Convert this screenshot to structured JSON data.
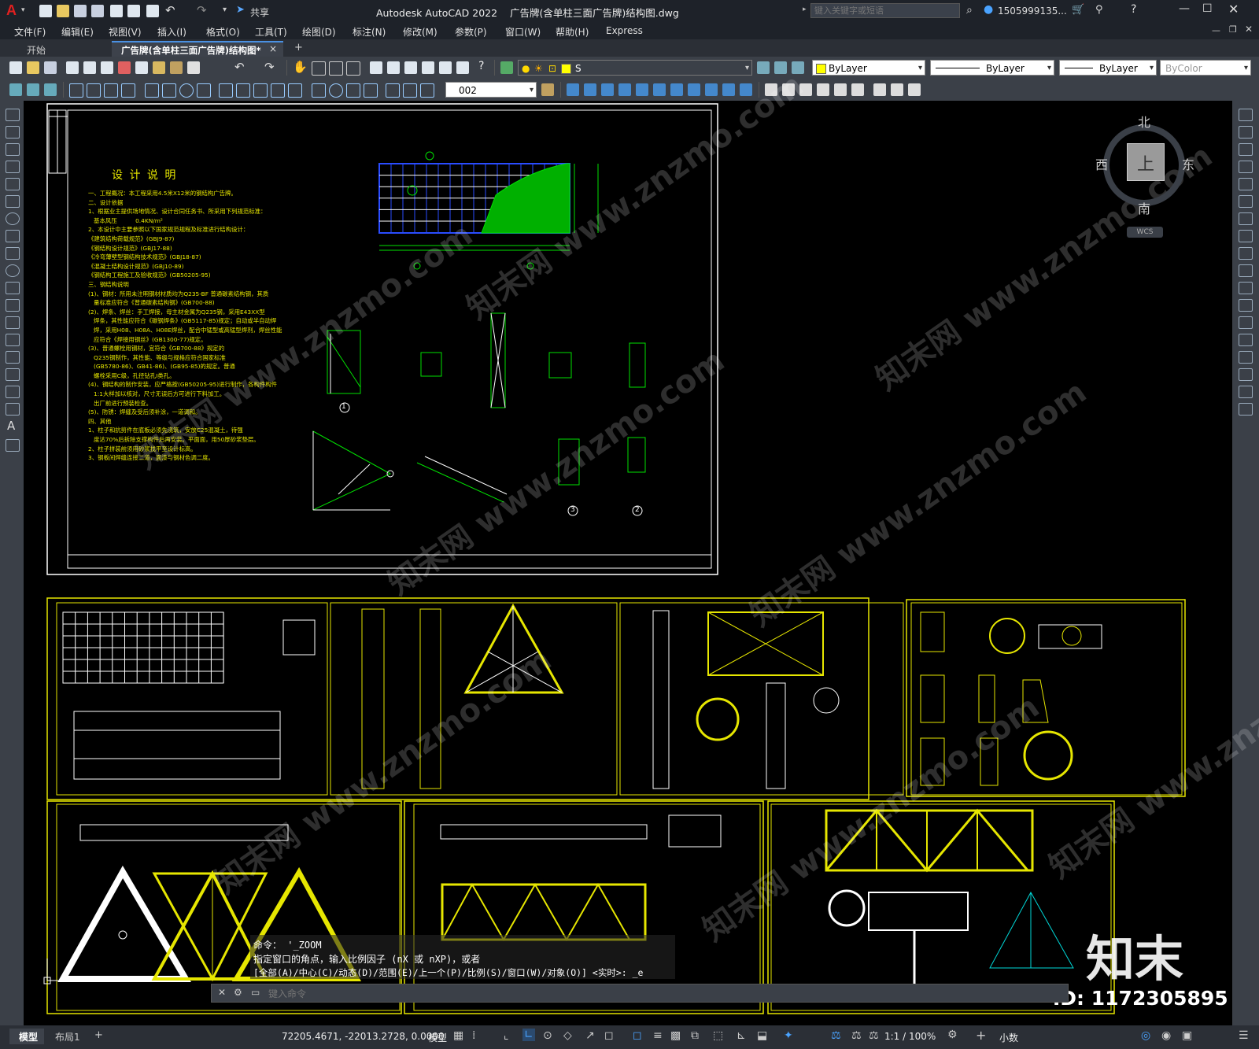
{
  "titlebar": {
    "app_logo": "A",
    "share_label": "共享",
    "title": "Autodesk AutoCAD 2022    广告牌(含单柱三面广告牌)结构图.dwg",
    "search_placeholder": "键入关键字或短语",
    "user": "1505999135...",
    "icons": [
      "new-icon",
      "open-icon",
      "save-icon",
      "saveas-icon",
      "plot-icon",
      "undo-icon",
      "redo-icon",
      "share-icon",
      "search-icon",
      "user-icon",
      "cart-icon",
      "help-icon",
      "minimize-icon",
      "maximize-icon",
      "close-icon"
    ]
  },
  "menubar": {
    "items": [
      "文件(F)",
      "编辑(E)",
      "视图(V)",
      "插入(I)",
      "格式(O)",
      "工具(T)",
      "绘图(D)",
      "标注(N)",
      "修改(M)",
      "参数(P)",
      "窗口(W)",
      "帮助(H)",
      "Express"
    ]
  },
  "tabs": {
    "start": "开始",
    "active": "广告牌(含单柱三面广告牌)结构图*",
    "close": "×",
    "add": "+"
  },
  "toolbar": {
    "layer_value": "S",
    "color_value": "ByLayer",
    "linetype_value": "ByLayer",
    "lineweight_value": "ByLayer",
    "plotstyle_value": "ByColor",
    "dimstyle_value": "002",
    "layer_color": "#ffff00"
  },
  "viewcube": {
    "north": "北",
    "south": "南",
    "east": "东",
    "west": "西",
    "top": "上",
    "wcs": "WCS"
  },
  "drawing": {
    "title": "设 计 说 明",
    "notes": [
      "一、工程概况：本工程采用4.5米X12米的钢结构广告牌。",
      "二、设计依据",
      "1、根据业主提供场地情况、设计合同任务书、所采用下列规范标准：",
      "   基本风压          0.4KN/m²",
      "2、本设计中主要参照以下国家规范规程及标准进行结构设计：",
      "《建筑结构荷载规范》(GBJ9-87)",
      "《钢结构设计规范》(GBJ17-88)",
      "《冷弯薄壁型钢结构技术规范》(GBJ18-87)",
      "《混凝土结构设计规范》(GBJ10-89)",
      "《钢结构工程施工及验收规范》(GB50205-95)",
      "三、钢结构说明",
      "(1)、钢材：所用未注明钢材材质均为Q235-BF 普通碳素结构钢，其质",
      "   量标准应符合《普通碳素结构钢》(GB700-88)",
      "(2)、焊条、焊丝：手工焊接，母主材金属为Q235钢，采用E43XX型",
      "   焊条，其性能应符合《碳钢焊条》(GB5117-85)规定；自动或半自动焊",
      "   焊，采用H08、H08A、H08E焊丝，配合中锰型或高锰型焊剂，焊丝性能",
      "   应符合《焊接用钢丝》(GB1300-77)规定。",
      "(3)、普通螺栓用钢材，宜符合《GB700-88》规定的",
      "   Q235钢制作，其性能、等级与规格应符合国家标准",
      "   (GB5780-86)、GB41-86)、(GB95-85)的规定。普通",
      "   螺栓采用C级，孔径钻孔I类孔。",
      "(4)、钢结构的制作安装，应严格按(GB50205-95)进行制作，各构件构件",
      "   1:1大样加以核对，尺寸无误后方可进行下料加工。",
      "   出厂前进行预装检查。",
      "(5)、防锈：焊缝及受后须补涂，一道调和。",
      "四、其他",
      "1、柱子和抗剪件在底板必须先浇筑，安放C25混凝土，待强",
      "   度达70%后拆除支撑构件后再安装。平面面，用50厚砂浆垫层。",
      "2、柱子拼装前须用砂浆找平至设计标高。",
      "3、钢板间焊缝连接二道，面漆与钢材色调二度。"
    ],
    "detail_labels": [
      "1",
      "2",
      "3"
    ],
    "watermark": "知末网 www.znzmo.com"
  },
  "commandline": {
    "history": [
      "命令： '_ZOOM",
      "指定窗口的角点，输入比例因子 (nX 或 nXP)，或者",
      "[全部(A)/中心(C)/动态(D)/范围(E)/上一个(P)/比例(S)/窗口(W)/对象(O)] <实时>: _e"
    ],
    "input_placeholder": "键入命令"
  },
  "statusbar": {
    "model_tab": "模型",
    "layout_tab": "布局1",
    "add_tab": "+",
    "coords": "72205.4671, -22013.2728, 0.0000",
    "space": "模型",
    "scale": "1:1 / 100%",
    "units": "小数"
  },
  "brand": {
    "logo_text": "知末",
    "id_text": "ID: 1172305895"
  }
}
